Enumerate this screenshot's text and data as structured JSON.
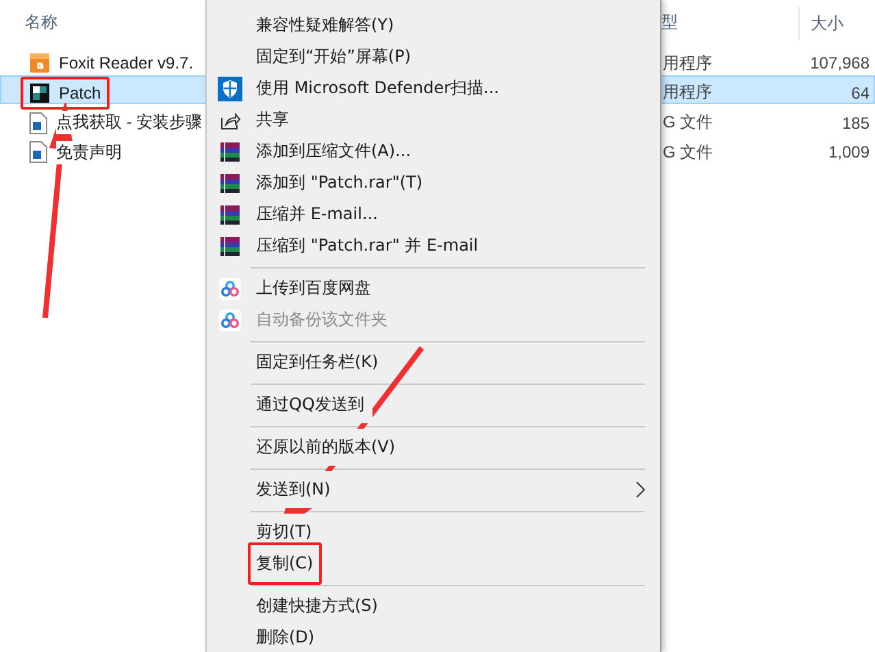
{
  "columns": [
    {
      "label": "名称"
    },
    {
      "label": "型"
    },
    {
      "label": "大小"
    }
  ],
  "files": [
    {
      "name": "Foxit Reader v9.7.",
      "type": "用程序",
      "size": "107,968",
      "selected": false,
      "annotated": false
    },
    {
      "name": "Patch",
      "type": "用程序",
      "size": "64",
      "selected": true,
      "annotated": true
    },
    {
      "name": "点我获取 - 安装步骤",
      "type": "G 文件",
      "size": "185",
      "selected": false,
      "annotated": false
    },
    {
      "name": "免责声明",
      "type": "G 文件",
      "size": "1,009",
      "selected": false,
      "annotated": false
    }
  ],
  "context_menu": [
    {
      "kind": "plain",
      "label": "兼容性疑难解答(Y)",
      "disabled": false,
      "submenu": false,
      "annotated": false
    },
    {
      "kind": "plain",
      "label": "固定到“开始”屏幕(P)",
      "disabled": false,
      "submenu": false,
      "annotated": false
    },
    {
      "kind": "shield",
      "label": "使用 Microsoft Defender扫描...",
      "disabled": false,
      "submenu": false,
      "annotated": false
    },
    {
      "kind": "share",
      "label": "共享",
      "disabled": false,
      "submenu": false,
      "annotated": false
    },
    {
      "kind": "archive",
      "label": "添加到压缩文件(A)...",
      "disabled": false,
      "submenu": false,
      "annotated": false
    },
    {
      "kind": "archive",
      "label": "添加到 \"Patch.rar\"(T)",
      "disabled": false,
      "submenu": false,
      "annotated": false
    },
    {
      "kind": "archive",
      "label": "压缩并 E-mail...",
      "disabled": false,
      "submenu": false,
      "annotated": false
    },
    {
      "kind": "archive",
      "label": "压缩到 \"Patch.rar\" 并 E-mail",
      "disabled": false,
      "submenu": false,
      "annotated": false
    },
    {
      "kind": "separator"
    },
    {
      "kind": "cloud",
      "label": "上传到百度网盘",
      "disabled": false,
      "submenu": false,
      "annotated": false
    },
    {
      "kind": "cloud",
      "label": "自动备份该文件夹",
      "disabled": true,
      "submenu": false,
      "annotated": false
    },
    {
      "kind": "separator"
    },
    {
      "kind": "plain",
      "label": "固定到任务栏(K)",
      "disabled": false,
      "submenu": false,
      "annotated": false
    },
    {
      "kind": "separator"
    },
    {
      "kind": "plain",
      "label": "通过QQ发送到",
      "disabled": false,
      "submenu": false,
      "annotated": false
    },
    {
      "kind": "separator"
    },
    {
      "kind": "plain",
      "label": "还原以前的版本(V)",
      "disabled": false,
      "submenu": false,
      "annotated": false
    },
    {
      "kind": "separator"
    },
    {
      "kind": "plain",
      "label": "发送到(N)",
      "disabled": false,
      "submenu": true,
      "annotated": false
    },
    {
      "kind": "separator"
    },
    {
      "kind": "plain",
      "label": "剪切(T)",
      "disabled": false,
      "submenu": false,
      "annotated": false
    },
    {
      "kind": "plain",
      "label": "复制(C)",
      "disabled": false,
      "submenu": false,
      "annotated": true
    },
    {
      "kind": "separator"
    },
    {
      "kind": "plain",
      "label": "创建快捷方式(S)",
      "disabled": false,
      "submenu": false,
      "annotated": false
    },
    {
      "kind": "plain",
      "label": "删除(D)",
      "disabled": false,
      "submenu": false,
      "annotated": false
    }
  ]
}
